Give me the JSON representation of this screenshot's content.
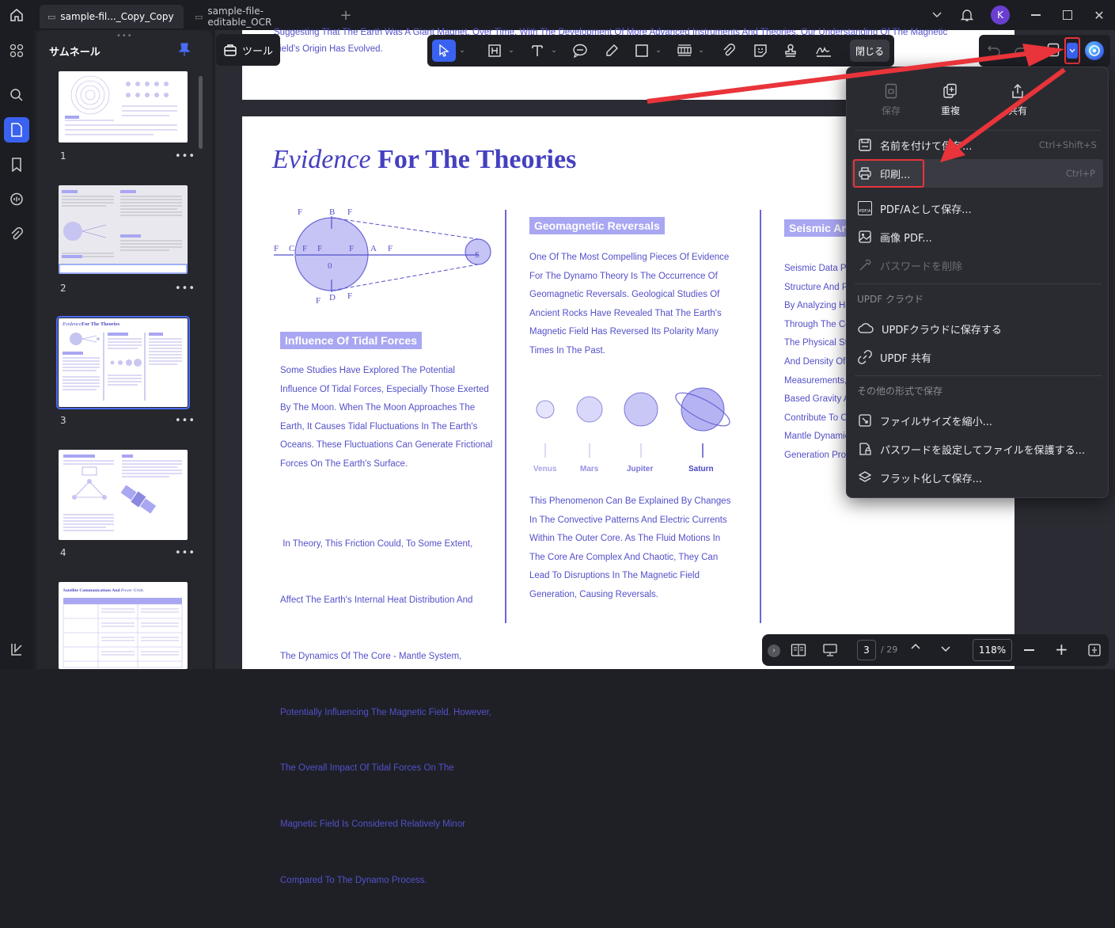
{
  "tabs": [
    {
      "label": "sample-fil..._Copy_Copy",
      "active": true
    },
    {
      "label": "sample-file-editable_OCR",
      "active": false
    }
  ],
  "user_initial": "K",
  "sidebar": {
    "title": "サムネール",
    "pages": [
      "1",
      "2",
      "3",
      "4"
    ],
    "more": "•••"
  },
  "tool_button": "ツール",
  "close_button": "閉じる",
  "document": {
    "top_line1": "Suggesting That The Earth Was A Giant Magnet. Over Time, With The Development Of More Advanced Instruments And Theories, Our Understanding Of The Magnetic",
    "top_line2": "Field's Origin Has Evolved.",
    "title_italic": "Evidence",
    "title_bold": "For The Theories",
    "col1_heading": "Influence Of Tidal Forces",
    "col1_para1": [
      "Some Studies Have Explored The Potential",
      "Influence Of Tidal Forces, Especially Those Exerted",
      "By The Moon. When The Moon Approaches The",
      "Earth, It Causes Tidal Fluctuations In The Earth's",
      "Oceans. These Fluctuations Can Generate Frictional",
      "Forces On The Earth's Surface."
    ],
    "col1_para2": [
      " In Theory, This Friction Could, To Some Extent,",
      "Affect The Earth's Internal Heat Distribution And",
      "The Dynamics Of The Core - Mantle System,",
      "Potentially Influencing The Magnetic Field. However,",
      "The Overall Impact Of Tidal Forces On The",
      "Magnetic Field Is Considered Relatively Minor",
      "Compared To The Dynamo Process."
    ],
    "col2_heading": "Geomagnetic Reversals",
    "col2_para1": [
      "One Of The Most Compelling Pieces Of Evidence",
      "For The Dynamo Theory Is The Occurrence Of",
      "Geomagnetic Reversals. Geological Studies Of",
      "Ancient Rocks Have Revealed That The Earth's",
      "Magnetic Field Has Reversed Its Polarity Many",
      "Times In The Past."
    ],
    "planets": [
      "Venus",
      "Mars",
      "Jupiter",
      "Saturn"
    ],
    "col2_para2": [
      "This Phenomenon Can Be Explained By Changes",
      "In The Convective Patterns And Electric Currents",
      "Within The Outer Core. As The Fluid Motions In",
      "The Core Are Complex And Chaotic, They Can",
      "Lead To Disruptions In The Magnetic Field",
      "Generation, Causing Reversals."
    ],
    "col3_heading": "Seismic An",
    "col3_lines": [
      "Seismic Data Pr",
      "Structure And P",
      "By Analyzing He",
      "Through The Co",
      "The Physical St",
      "And Density Of",
      "Measurements,",
      "Based Gravity A",
      "Contribute To O",
      "Mantle Dynamic",
      "Generation Proc"
    ],
    "diagram_labels": {
      "fl": "F",
      "c": "C",
      "fg": "F",
      "b": "B",
      "zero": "0",
      "a": "A",
      "d": "D",
      "s": "S"
    }
  },
  "menu": {
    "top": [
      {
        "label": "保存",
        "disabled": true
      },
      {
        "label": "重複",
        "disabled": false
      },
      {
        "label": "共有",
        "disabled": false
      }
    ],
    "items": [
      {
        "label": "名前を付けて保存...",
        "shortcut": "Ctrl+Shift+S"
      },
      {
        "label": "印刷...",
        "shortcut": "Ctrl+P"
      },
      {
        "label": "PDF/Aとして保存...",
        "shortcut": ""
      },
      {
        "label": "画像 PDF...",
        "shortcut": ""
      },
      {
        "label": "パスワードを削除",
        "shortcut": ""
      }
    ],
    "cloud_label": "UPDF クラウド",
    "cloud_items": [
      "UPDFクラウドに保存する",
      "UPDF 共有"
    ],
    "other_label": "その他の形式で保存",
    "other_items": [
      "ファイルサイズを縮小...",
      "パスワードを設定してファイルを保護する...",
      "フラット化して保存..."
    ],
    "pdfa_icon_text": "PDF/A"
  },
  "bottom": {
    "page": "3",
    "total": "/ 29",
    "zoom": "118%"
  }
}
